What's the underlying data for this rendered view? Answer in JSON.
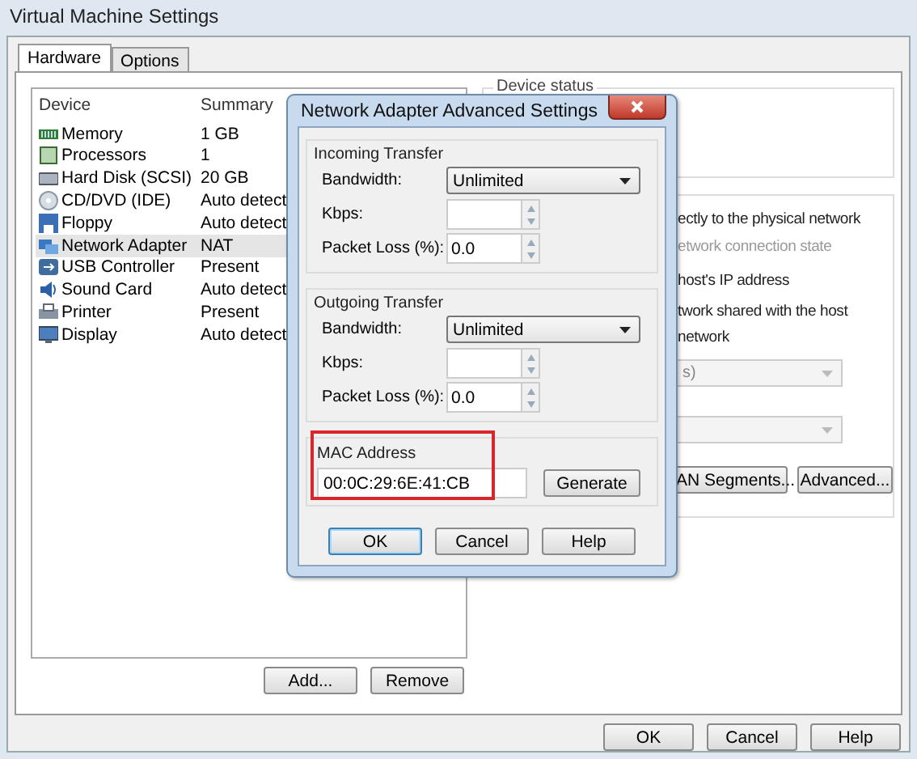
{
  "window": {
    "title": "Virtual Machine Settings"
  },
  "tabs": [
    {
      "label": "Hardware",
      "selected": true
    },
    {
      "label": "Options",
      "selected": false
    }
  ],
  "device_list": {
    "columns": [
      "Device",
      "Summary"
    ],
    "rows": [
      {
        "kind": "memory",
        "device": "Memory",
        "summary": "1 GB",
        "selected": false
      },
      {
        "kind": "processor",
        "device": "Processors",
        "summary": "1",
        "selected": false
      },
      {
        "kind": "disk",
        "device": "Hard Disk (SCSI)",
        "summary": "20 GB",
        "selected": false
      },
      {
        "kind": "cd",
        "device": "CD/DVD (IDE)",
        "summary": "Auto detect",
        "selected": false
      },
      {
        "kind": "floppy",
        "device": "Floppy",
        "summary": "Auto detect",
        "selected": false
      },
      {
        "kind": "network",
        "device": "Network Adapter",
        "summary": "NAT",
        "selected": true
      },
      {
        "kind": "usb",
        "device": "USB Controller",
        "summary": "Present",
        "selected": false
      },
      {
        "kind": "sound",
        "device": "Sound Card",
        "summary": "Auto detect",
        "selected": false
      },
      {
        "kind": "printer",
        "device": "Printer",
        "summary": "Present",
        "selected": false
      },
      {
        "kind": "display",
        "device": "Display",
        "summary": "Auto detect",
        "selected": false
      }
    ]
  },
  "device_buttons": [
    "Add...",
    "Remove"
  ],
  "device_status": {
    "title": "Device status"
  },
  "connection": {
    "lines": [
      {
        "text": "ectly to the physical network",
        "disabled": false
      },
      {
        "text": "etwork connection state",
        "disabled": true
      },
      {
        "text": "host's IP address",
        "disabled": false
      },
      {
        "text": "twork shared with the host",
        "disabled": false
      },
      {
        "text": "network",
        "disabled": false
      }
    ],
    "dropdowns": [
      {
        "value": "s)",
        "disabled": true
      },
      {
        "disabled": true
      }
    ],
    "buttons": [
      "AN Segments...",
      "Advanced..."
    ]
  },
  "dialog": {
    "title": "Network Adapter Advanced Settings",
    "groups": [
      {
        "title": "Incoming Transfer",
        "bandwidth_label": "Bandwidth:",
        "bandwidth": "Unlimited",
        "kbps_label": "Kbps:",
        "packet_loss_label": "Packet Loss (%):",
        "packet_loss": "0.0"
      },
      {
        "title": "Outgoing Transfer",
        "bandwidth_label": "Bandwidth:",
        "bandwidth": "Unlimited",
        "kbps_label": "Kbps:",
        "packet_loss_label": "Packet Loss (%):",
        "packet_loss": "0.0"
      }
    ],
    "mac": {
      "title": "MAC Address",
      "value": "00:0C:29:6E:41:CB",
      "highlighted": true
    },
    "generate_button": "Generate",
    "buttons": [
      "OK",
      "Cancel",
      "Help"
    ]
  },
  "buttons": [
    "OK",
    "Cancel",
    "Help"
  ]
}
